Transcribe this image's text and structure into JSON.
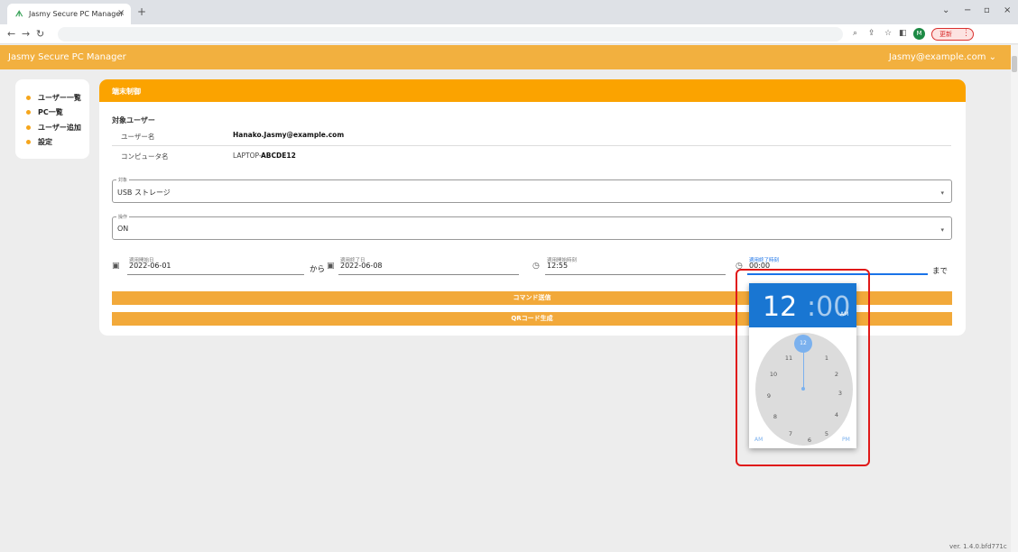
{
  "browser": {
    "tab_title": "Jasmy Secure PC Manager",
    "tab_logo": "ᗑ",
    "tab_close": "×",
    "new_tab": "+",
    "profile_initial": "M",
    "update_label": "更新",
    "menu_dots": "⋮",
    "icons": [
      "back-icon",
      "forward-icon",
      "reload-icon",
      "zoom-icon",
      "share-icon",
      "star-icon",
      "sidepanel-icon"
    ]
  },
  "app": {
    "title": "Jasmy Secure PC Manager",
    "user_menu": "Jasmy@example.com ⌄",
    "accent_color": "#f2b03f"
  },
  "sidebar": {
    "items": [
      {
        "label": "ユーザー一覧"
      },
      {
        "label": "PC一覧"
      },
      {
        "label": "ユーザー追加"
      },
      {
        "label": "設定"
      }
    ]
  },
  "card": {
    "title": "端末制御",
    "target_section": "対象ユーザー",
    "user_label": "ユーザー名",
    "user_value": "Hanako.Jasmy@example.com",
    "computer_label": "コンピュータ名",
    "computer_value_prefix": "LAPTOP-",
    "computer_value_bold": "ABCDE12",
    "target_field_label": "対象",
    "target_field_value": "USB ストレージ",
    "operation_field_label": "操作",
    "operation_field_value": "ON",
    "start_date_label": "適用開始日",
    "start_date_value": "2022-06-01",
    "from_text": "から",
    "end_date_label": "適用終了日",
    "end_date_value": "2022-06-08",
    "start_time_label": "適用開始時刻",
    "start_time_value": "12:55",
    "end_time_label": "適用終了時刻",
    "end_time_value": "00:00",
    "until_text": "まで",
    "send_button": "コマンド送信",
    "qr_button": "QRコード生成"
  },
  "time_picker": {
    "hour": "12",
    "minute": ":00",
    "ampm": "AM",
    "dial_numbers": [
      "1",
      "2",
      "3",
      "4",
      "5",
      "6",
      "7",
      "8",
      "9",
      "10",
      "11"
    ],
    "selected_hour": "12",
    "am_label": "AM",
    "pm_label": "PM"
  },
  "footer": {
    "version": "ver. 1.4.0.bfd771c"
  }
}
